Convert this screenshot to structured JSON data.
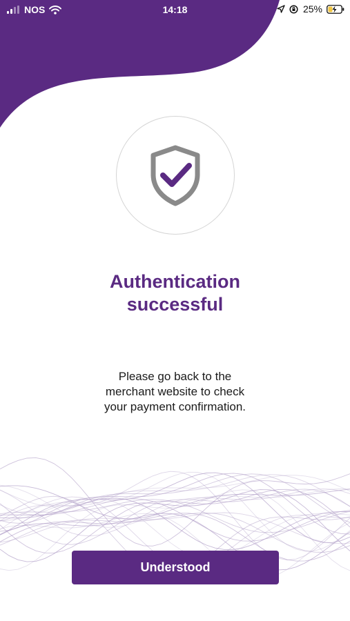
{
  "status_bar": {
    "carrier": "NOS",
    "time": "14:18",
    "battery_percent": "25%",
    "icons": [
      "signal-bars-icon",
      "wifi-icon",
      "location-arrow-icon",
      "orientation-lock-icon",
      "battery-charging-icon"
    ]
  },
  "content": {
    "icon": "shield-check-icon",
    "title_line1": "Authentication",
    "title_line2": "successful",
    "message_line1": "Please go back to the",
    "message_line2": "merchant website to check",
    "message_line3": "your payment confirmation."
  },
  "actions": {
    "understood_label": "Understood"
  },
  "colors": {
    "brand_purple": "#5a2a82",
    "shield_gray": "#8a8a8a",
    "wave_lavender": "#b3a2c9"
  }
}
